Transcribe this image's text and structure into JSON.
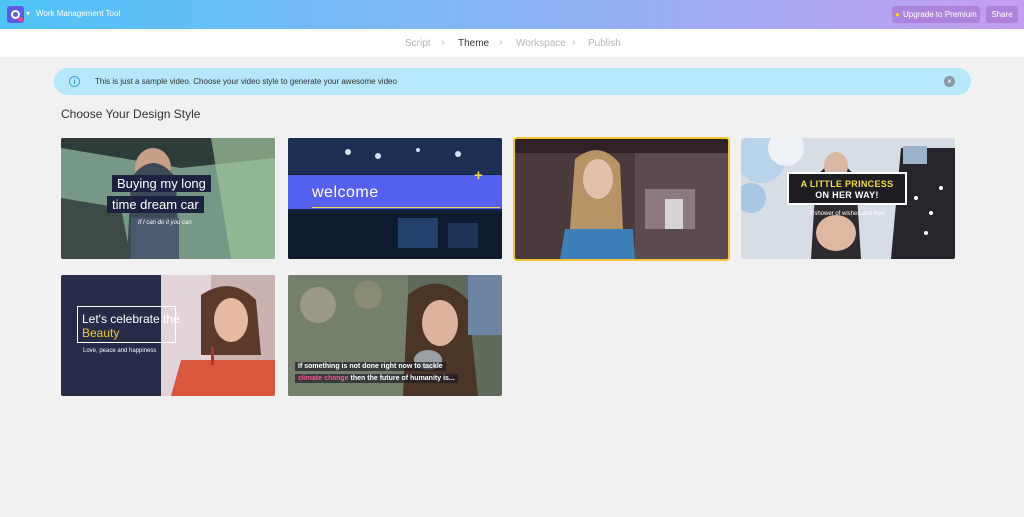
{
  "header": {
    "app_title": "Work Management Tool",
    "upgrade_label": "Upgrade to Premium",
    "share_label": "Share",
    "accent_gradient": [
      "#4fc4f6",
      "#c59cf0"
    ]
  },
  "steps": [
    {
      "label": "Script"
    },
    {
      "label": "Theme"
    },
    {
      "label": "Workspace"
    },
    {
      "label": "Publish"
    }
  ],
  "active_step": "Theme",
  "notice": {
    "text": "This is just a sample video. Choose your video style to generate your awesome video"
  },
  "section_title": "Choose Your Design Style",
  "styles": [
    {
      "line1": "Buying my long",
      "line2": "time dream car",
      "sub": "If I can do it you can"
    },
    {
      "word": "welcome"
    },
    {
      "selected": true
    },
    {
      "line1": "A LITTLE PRINCESS",
      "line2": "ON HER WAY!",
      "sub": "A shower of wishes and love"
    },
    {
      "line1": "Let's celebrate the",
      "line2": "Beauty",
      "sub": "Love, peace and happiness"
    },
    {
      "line1": "If something is not done right now to tackle",
      "line2_highlight": "climate change",
      "line2_rest": " then the future of humanity is..."
    }
  ],
  "colors": {
    "selected_outline": "#f3c43a",
    "notice_bg": "#b7e7fb",
    "welcome_band": "#5561ee"
  }
}
